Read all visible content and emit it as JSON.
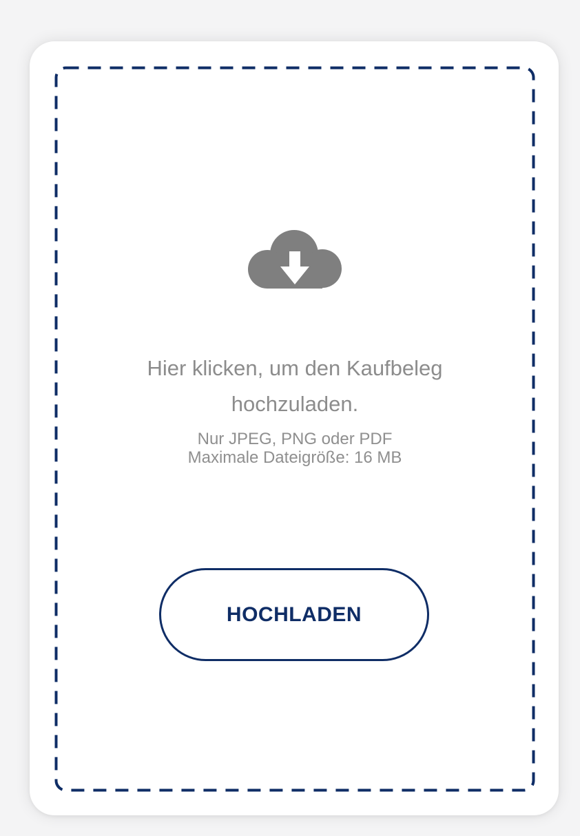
{
  "upload": {
    "headline": "Hier klicken, um den Kaufbeleg\nhochzuladen.",
    "formats_hint": "Nur JPEG, PNG oder PDF",
    "size_hint": "Maximale Dateigröße: 16 MB",
    "button_label": "HOCHLADEN",
    "icon": "cloud-download-icon"
  },
  "colors": {
    "accent": "#0f2d66",
    "icon": "#7f7f7f",
    "text": "#8c8c8c",
    "card": "#ffffff",
    "page": "#f4f4f5"
  }
}
